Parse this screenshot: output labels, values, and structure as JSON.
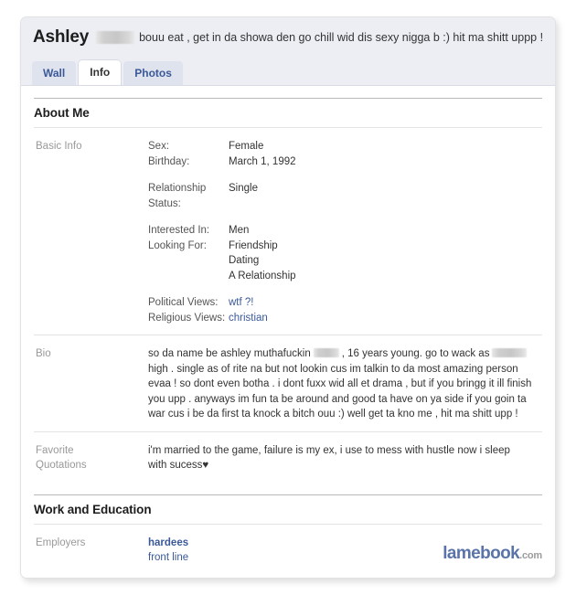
{
  "profile": {
    "name": "Ashley",
    "name_redacted": true,
    "status_text": "bouu eat , get in da showa den go chill wid dis sexy nigga b :) hit ma shitt uppp !",
    "tabs": [
      {
        "label": "Wall",
        "active": false
      },
      {
        "label": "Info",
        "active": true
      },
      {
        "label": "Photos",
        "active": false
      }
    ]
  },
  "sections": {
    "about": {
      "heading": "About Me",
      "basic_info": {
        "label": "Basic Info",
        "groups": [
          {
            "lines": [
              {
                "key": "Sex:",
                "value": "Female",
                "link": false
              },
              {
                "key": "Birthday:",
                "value": "March 1, 1992",
                "link": false
              }
            ]
          },
          {
            "lines": [
              {
                "key": "Relationship Status:",
                "value": "Single",
                "link": false
              }
            ]
          },
          {
            "lines": [
              {
                "key": "Interested In:",
                "value": "Men",
                "link": false
              },
              {
                "key": "Looking For:",
                "value": "Friendship",
                "link": false
              },
              {
                "key": "",
                "value": "Dating",
                "link": false
              },
              {
                "key": "",
                "value": "A Relationship",
                "link": false
              }
            ]
          },
          {
            "lines": [
              {
                "key": "Political Views:",
                "value": "wtf ?!",
                "link": true
              },
              {
                "key": "Religious Views:",
                "value": "christian",
                "link": true
              }
            ]
          }
        ]
      },
      "bio": {
        "label": "Bio",
        "text_part_1": "so da name be ashley muthafuckin",
        "text_part_2": ", 16 years young. go to wack as",
        "text_part_3": "high . single as of rite na but not lookin cus im talkin to da most amazing person evaa ! so dont even botha . i dont fuxx wid all et drama , but if you bringg it ill finish you upp . anyways im fun ta be around and good ta have on ya side if you goin ta war cus i be da first ta knock a bitch ouu :) well get ta kno me , hit ma shitt upp !"
      },
      "quotations": {
        "label_line_1": "Favorite",
        "label_line_2": "Quotations",
        "text": "i'm married to the game, failure is my ex, i use to mess with hustle now i sleep with sucess♥"
      }
    },
    "work": {
      "heading": "Work and Education",
      "employers": {
        "label": "Employers",
        "name": "hardees",
        "role": "front line"
      }
    }
  },
  "watermark": {
    "brand": "lamebook",
    "tld": ".com"
  },
  "colors": {
    "link": "#3b5998",
    "header_bg": "#eceef4",
    "tab_bg": "#dfe3ee",
    "label_gray": "#999999"
  }
}
